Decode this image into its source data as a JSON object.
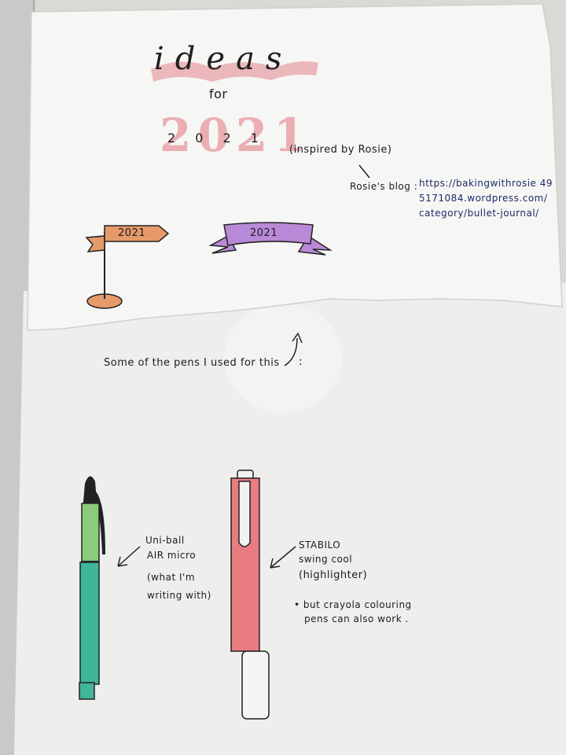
{
  "top_sheet": {
    "title": "ideas",
    "subtitle": "for",
    "year": "2021",
    "year_spaced": "2 0 2 1",
    "note": "(inspired by Rosie)",
    "blog_label": "Rosie's blog :",
    "blog_url_lines": [
      "https://bakingwithrosie 49",
      "5171084.wordpress.com/",
      "category/bullet-journal/"
    ],
    "flag_banner_text": "2021",
    "ribbon_banner_text": "2021"
  },
  "bottom_sheet": {
    "pens_caption": "Some of the pens I used for this",
    "pen1_label_lines": [
      "Uni-ball",
      "AIR micro",
      "(what I'm",
      "writing with)"
    ],
    "pen2_label_lines": [
      "STABILO",
      "swing cool",
      "(highlighter)"
    ],
    "note_lines": [
      "• but crayola colouring",
      "pens can also work ."
    ]
  },
  "colors": {
    "title_pink": "#e8a2a8",
    "flag_orange": "#e69a6a",
    "ribbon_purple": "#b889d6",
    "pen1_green": "#8ccb7a",
    "pen1_teal": "#3fb59a",
    "pen2_pink": "#e97c80",
    "url_ink": "#1e2a66"
  }
}
